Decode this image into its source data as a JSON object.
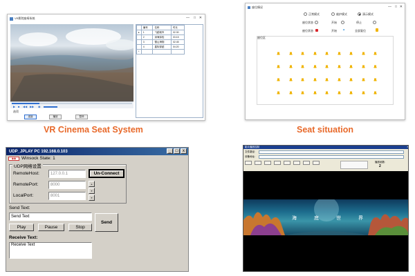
{
  "captions": {
    "vr": "VR Cinema Seat System",
    "seat": "Seat situation"
  },
  "vr_window": {
    "title": "VR影院座椅系统",
    "group_label": "选项",
    "buttons": [
      "连接",
      "播放",
      "暂停"
    ],
    "table_headers": [
      "编号",
      "名称",
      "时长"
    ],
    "table_rows": [
      [
        "1",
        "飞越城市",
        "02:30"
      ],
      [
        "2",
        "深海探险",
        "03:15"
      ],
      [
        "3",
        "雪山滑翔",
        "02:45"
      ],
      [
        "4",
        "星际穿越",
        "04:20"
      ]
    ],
    "row_marker": "▸",
    "new_row_marker": "*"
  },
  "seat_window": {
    "title": "座位情况",
    "radios": [
      "正常模式",
      "维护模式",
      "演示模式"
    ],
    "row2": [
      "座位状态",
      "开始",
      "停止",
      "全部复位"
    ],
    "area_label": "座位区",
    "seat_color": "#f0b400",
    "rows": 4,
    "cols": 9
  },
  "udp_window": {
    "title": "UDP_JPLAY PC  192.168.0.103",
    "status": "Winsock State:  1",
    "group_label": "UDP网络设置",
    "remote_host_label": "RemoteHost:",
    "remote_host_value": "127.0.0.1",
    "remote_port_label": "RemotePort:",
    "remote_port_value": "8000",
    "local_port_label": "LocalPort:",
    "local_port_value": "8001",
    "unconnect_label": "Un-Connect",
    "send_label": "Send Text:",
    "send_value": "Send Text",
    "play_label": "Play",
    "pause_label": "Pause",
    "stop_label": "Stop",
    "send_button": "Send",
    "receive_label": "Receive Text:",
    "receive_value": "Receive Text"
  },
  "media_window": {
    "title": "影片播放控制",
    "field1_label": "文件路径:",
    "field2_label": "设备地址:",
    "counter_label": "播放帧数:",
    "counter_value": "2",
    "overlay_chars": [
      "海",
      "底",
      "世",
      "界"
    ]
  }
}
